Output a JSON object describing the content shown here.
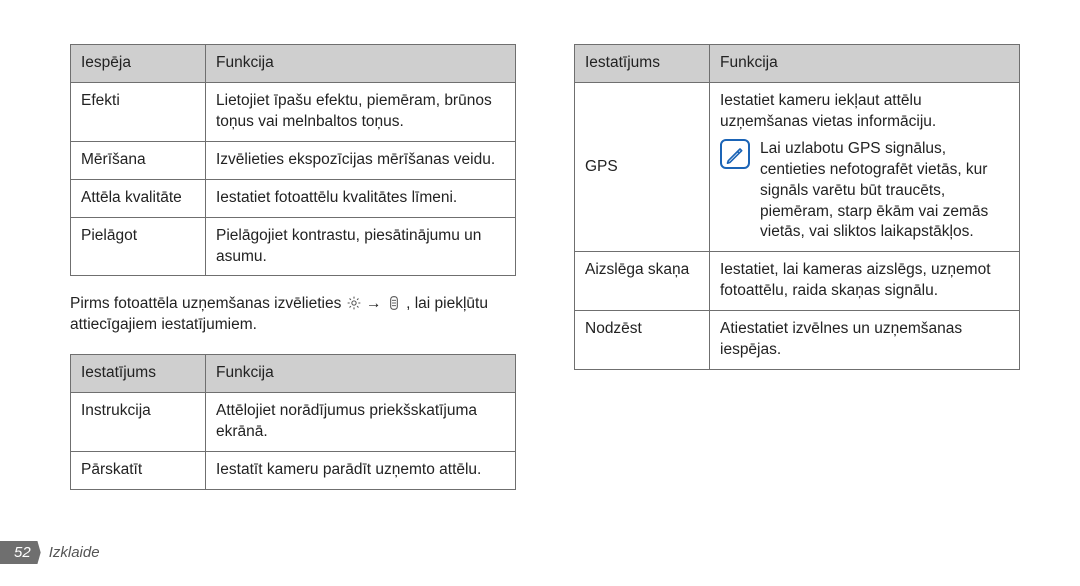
{
  "left": {
    "table1": {
      "headers": [
        "Iespēja",
        "Funkcija"
      ],
      "rows": [
        [
          "Efekti",
          "Lietojiet īpašu efektu, piemēram, brūnos toņus vai melnbaltos toņus."
        ],
        [
          "Mērīšana",
          "Izvēlieties ekspozīcijas mērīšanas veidu."
        ],
        [
          "Attēla kvalitāte",
          "Iestatiet fotoattēlu kvalitātes līmeni."
        ],
        [
          "Pielāgot",
          "Pielāgojiet kontrastu, piesātinājumu un asumu."
        ]
      ]
    },
    "paragraph": {
      "before_icon1": "Pirms fotoattēla uzņemšanas izvēlieties ",
      "between": " → ",
      "after_icon2": ", lai piekļūtu attiecīgajiem iestatījumiem."
    },
    "table2": {
      "headers": [
        "Iestatījums",
        "Funkcija"
      ],
      "rows": [
        [
          "Instrukcija",
          "Attēlojiet norādījumus priekšskatījuma ekrānā."
        ],
        [
          "Pārskatīt",
          "Iestatīt kameru parādīt uzņemto attēlu."
        ]
      ]
    }
  },
  "right": {
    "table": {
      "headers": [
        "Iestatījums",
        "Funkcija"
      ],
      "rows": [
        {
          "label": "GPS",
          "line1": "Iestatiet kameru iekļaut attēlu uzņemšanas vietas informāciju.",
          "note": "Lai uzlabotu GPS signālus, centieties nefotografēt vietās, kur signāls varētu būt traucēts, piemēram, starp ēkām vai zemās vietās, vai sliktos laikapstākļos."
        },
        {
          "label": "Aizslēga skaņa",
          "line1": "Iestatiet, lai kameras aizslēgs, uzņemot fotoattēlu, raida skaņas signālu."
        },
        {
          "label": "Nodzēst",
          "line1": "Atiestatiet izvēlnes un uzņemšanas iespējas."
        }
      ]
    }
  },
  "footer": {
    "page_number": "52",
    "section": "Izklaide"
  },
  "icons": {
    "gear": "gear-icon",
    "sliders": "sliders-icon",
    "note": "note-memo-icon"
  }
}
